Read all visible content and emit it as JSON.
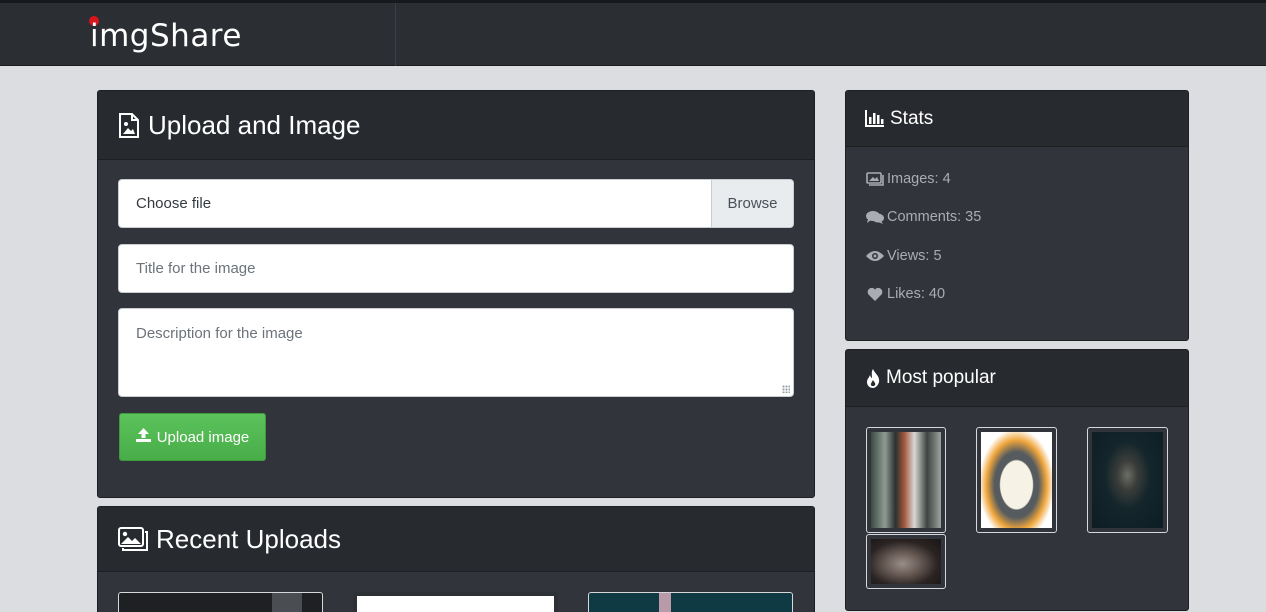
{
  "navbar": {
    "brand": "imgShare"
  },
  "upload": {
    "title": "Upload and Image",
    "file_label": "Choose file",
    "browse_label": "Browse",
    "title_placeholder": "Title for the image",
    "description_placeholder": "Description for the image",
    "submit_label": "Upload image"
  },
  "recent": {
    "title": "Recent Uploads"
  },
  "stats": {
    "title": "Stats",
    "images": "Images: 4",
    "comments": "Comments: 35",
    "views": "Views: 5",
    "likes": "Likes: 40"
  },
  "popular": {
    "title": "Most popular"
  },
  "colors": {
    "brand_dot": "#d9141d",
    "upload_button": "#5cb85c",
    "panel_bg": "#31343a",
    "panel_header_bg": "#272a2f",
    "page_bg": "#dcdde0"
  },
  "icons": {
    "upload_header": "file-image-icon",
    "recent_header": "images-icon",
    "stats_header": "bar-chart-icon",
    "images_stat": "images-icon",
    "comments_stat": "comments-icon",
    "views_stat": "eye-icon",
    "likes_stat": "heart-icon",
    "popular_header": "fire-icon",
    "upload_button": "upload-icon"
  }
}
